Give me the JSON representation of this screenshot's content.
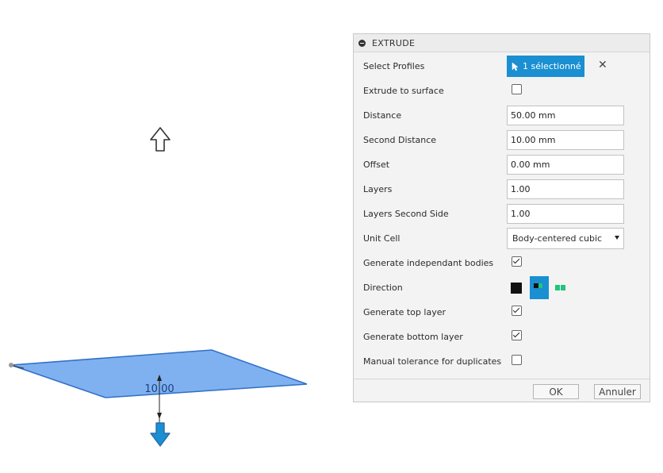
{
  "viewport": {
    "dimension_label": "10.00"
  },
  "panel": {
    "title": "EXTRUDE",
    "rows": {
      "select_profiles": {
        "label": "Select Profiles",
        "button": "1 sélectionné",
        "clear": "✕"
      },
      "extrude_to_surface": {
        "label": "Extrude to surface",
        "checked": false
      },
      "distance": {
        "label": "Distance",
        "value": "50.00 mm"
      },
      "second_distance": {
        "label": "Second Distance",
        "value": "10.00 mm"
      },
      "offset": {
        "label": "Offset",
        "value": "0.00 mm"
      },
      "layers": {
        "label": "Layers",
        "value": "1.00"
      },
      "layers_second_side": {
        "label": "Layers Second Side",
        "value": "1.00"
      },
      "unit_cell": {
        "label": "Unit Cell",
        "value": "Body-centered cubic"
      },
      "generate_independant": {
        "label": "Generate independant bodies",
        "checked": true
      },
      "direction": {
        "label": "Direction",
        "selected": "symmetric"
      },
      "generate_top": {
        "label": "Generate top layer",
        "checked": true
      },
      "generate_bottom": {
        "label": "Generate bottom layer",
        "checked": true
      },
      "manual_tolerance": {
        "label": "Manual tolerance for duplicates",
        "checked": false
      }
    },
    "footer": {
      "ok": "OK",
      "cancel": "Annuler"
    }
  },
  "colors": {
    "accent": "#1a8fd2",
    "profile_fill": "#7fb1f0",
    "profile_edge": "#2f6fc8",
    "green": "#1fc47f"
  }
}
